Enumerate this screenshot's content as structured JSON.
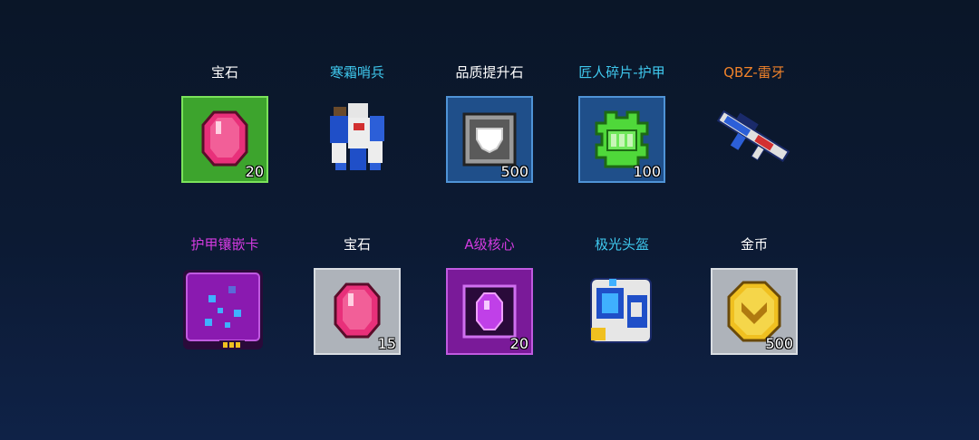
{
  "rewards": [
    {
      "name": "宝石",
      "name_color": "#ffffff",
      "tile": "green",
      "qty": "20",
      "icon": "gem-icon"
    },
    {
      "name": "寒霜哨兵",
      "name_color": "#3fc8ee",
      "tile": "none",
      "qty": "",
      "icon": "frost-sentinel-armor-icon"
    },
    {
      "name": "品质提升石",
      "name_color": "#ffffff",
      "tile": "blue",
      "qty": "500",
      "icon": "upgrade-stone-icon"
    },
    {
      "name": "匠人碎片-护甲",
      "name_color": "#3fc8ee",
      "tile": "blue",
      "qty": "100",
      "icon": "craftsman-shard-armor-icon"
    },
    {
      "name": "QBZ-雷牙",
      "name_color": "#f0822a",
      "tile": "none",
      "qty": "",
      "icon": "rifle-icon"
    },
    {
      "name": "护甲镶嵌卡",
      "name_color": "#d33be0",
      "tile": "none",
      "qty": "",
      "icon": "armor-inlay-card-icon"
    },
    {
      "name": "宝石",
      "name_color": "#ffffff",
      "tile": "gray",
      "qty": "15",
      "icon": "gem-icon"
    },
    {
      "name": "A级核心",
      "name_color": "#d33be0",
      "tile": "purple",
      "qty": "20",
      "icon": "a-grade-core-icon"
    },
    {
      "name": "极光头盔",
      "name_color": "#3fc8ee",
      "tile": "none",
      "qty": "",
      "icon": "aurora-helmet-icon"
    },
    {
      "name": "金币",
      "name_color": "#ffffff",
      "tile": "gray",
      "qty": "500",
      "icon": "gold-coin-icon"
    }
  ]
}
